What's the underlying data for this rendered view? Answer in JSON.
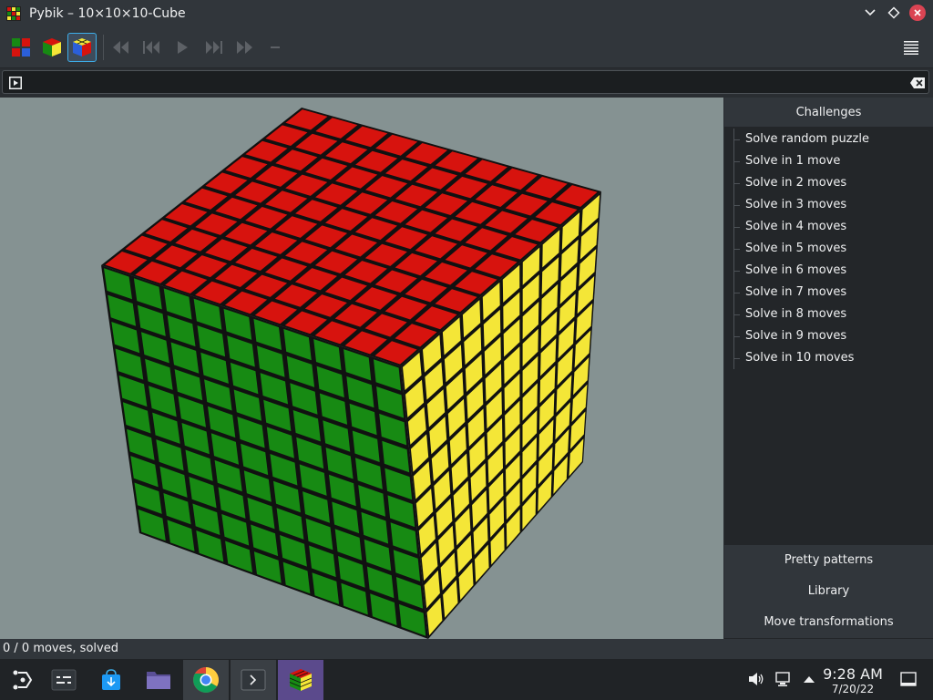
{
  "window": {
    "title": "Pybik – 10×10×10-Cube"
  },
  "toolbar": {
    "buttons": [
      "new-random-icon",
      "new-solved-icon",
      "selected-model-icon",
      "rewind-icon",
      "previous-icon",
      "play-icon",
      "next-icon",
      "forward-icon",
      "minus-icon"
    ],
    "menu_icon": "hamburger-icon"
  },
  "editbar": {
    "value": ""
  },
  "cube": {
    "size": 10,
    "colors": {
      "top": "#d7130e",
      "left": "#178a13",
      "right": "#f4e637",
      "gap": "#111111"
    }
  },
  "sidebar": {
    "header": "Challenges",
    "items": [
      "Solve random puzzle",
      "Solve in 1 move",
      "Solve in 2 moves",
      "Solve in 3 moves",
      "Solve in 4 moves",
      "Solve in 5 moves",
      "Solve in 6 moves",
      "Solve in 7 moves",
      "Solve in 8 moves",
      "Solve in 9 moves",
      "Solve in 10 moves"
    ],
    "bottom_buttons": [
      "Pretty patterns",
      "Library",
      "Move transformations"
    ]
  },
  "status": {
    "text": "0 / 0 moves, solved"
  },
  "taskbar": {
    "clock_time": "9:28 AM",
    "clock_date": "7/20/22",
    "apps": [
      "launcher-icon",
      "task-switcher-icon",
      "discover-store-icon",
      "file-manager-icon",
      "chrome-icon",
      "terminal-icon",
      "pybik-icon"
    ]
  }
}
